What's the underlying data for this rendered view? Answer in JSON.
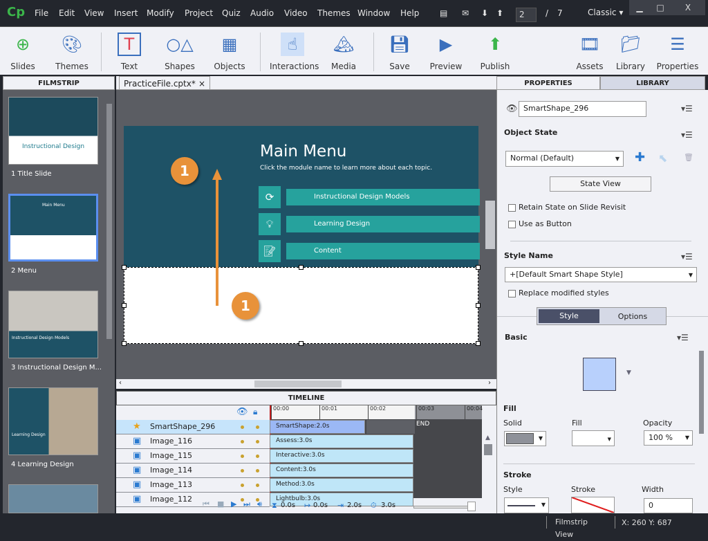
{
  "app": {
    "logo": "Cp",
    "menu": [
      "File",
      "Edit",
      "View",
      "Insert",
      "Modify",
      "Project",
      "Quiz",
      "Audio",
      "Video",
      "Themes",
      "Window",
      "Help"
    ],
    "current_slide": "2",
    "slide_sep": "/",
    "total_slides": "7",
    "workspace": "Classic"
  },
  "toolbar": [
    "Slides",
    "Themes",
    "Text",
    "Shapes",
    "Objects",
    "Interactions",
    "Media",
    "Save",
    "Preview",
    "Publish",
    "Assets",
    "Library",
    "Properties"
  ],
  "filmstrip": {
    "title": "FILMSTRIP",
    "slides": [
      {
        "label": "1 Title Slide",
        "thumb_title": "Instructional Design"
      },
      {
        "label": "2 Menu",
        "thumb_title": "Main Menu"
      },
      {
        "label": "3 Instructional Design M...",
        "thumb_title": "Instructional Design Models"
      },
      {
        "label": "4 Learning Design",
        "thumb_title": "Learning Design"
      }
    ]
  },
  "document": {
    "tab": "PracticeFile.cptx*",
    "close": "×"
  },
  "slide": {
    "title": "Main Menu",
    "subtitle": "Click the module name to learn more about each topic.",
    "buttons": [
      "Instructional Design Models",
      "Learning Design",
      "Content"
    ],
    "callout": "1"
  },
  "timeline": {
    "title": "TIMELINE",
    "ticks": [
      "00:00",
      "00:01",
      "00:02",
      "00:03",
      "00:04"
    ],
    "rows": [
      {
        "name": "SmartShape_296",
        "bar": "SmartShape:2.0s",
        "dur": 2
      },
      {
        "name": "Image_116",
        "bar": "Assess:3.0s",
        "dur": 3
      },
      {
        "name": "Image_115",
        "bar": "Interactive:3.0s",
        "dur": 3
      },
      {
        "name": "Image_114",
        "bar": "Content:3.0s",
        "dur": 3
      },
      {
        "name": "Image_113",
        "bar": "Method:3.0s",
        "dur": 3
      },
      {
        "name": "Image_112",
        "bar": "Lightbulb:3.0s",
        "dur": 3
      }
    ],
    "end": "END",
    "start_time": "0.0s",
    "in_time": "0.0s",
    "obj_duration": "2.0s",
    "slide_duration": "3.0s"
  },
  "properties": {
    "tabs": [
      "PROPERTIES",
      "LIBRARY"
    ],
    "object_name": "SmartShape_296",
    "object_state_heading": "Object State",
    "state": "Normal (Default)",
    "state_view": "State View",
    "retain_state": "Retain State on Slide Revisit",
    "use_as_button": "Use as Button",
    "style_name_heading": "Style Name",
    "style_name": "+[Default Smart Shape Style]",
    "replace_styles": "Replace modified styles",
    "subtabs": [
      "Style",
      "Options"
    ],
    "basic": "Basic",
    "fill_heading": "Fill",
    "fill_labels": [
      "Solid",
      "Fill",
      "Opacity"
    ],
    "opacity": "100 %",
    "stroke_heading": "Stroke",
    "stroke_labels": [
      "Style",
      "Stroke",
      "Width"
    ],
    "width": "0",
    "shape_color": "#b8d0fc"
  },
  "status": {
    "view": "Filmstrip View",
    "coords": "X: 260 Y: 687"
  }
}
